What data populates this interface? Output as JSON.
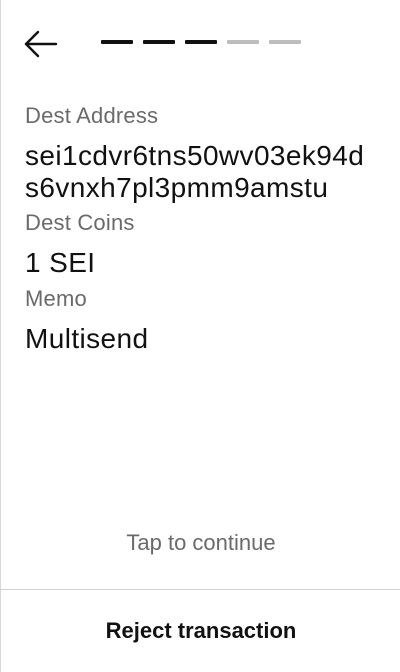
{
  "header": {
    "back_icon": "arrow-left-icon",
    "progress": {
      "total_steps": 5,
      "completed_steps": 3,
      "active_color": "#111111",
      "inactive_color": "#bdbdbd"
    }
  },
  "fields": {
    "dest_address": {
      "label": "Dest Address",
      "value": "sei1cdvr6tns50wv03ek94ds6vnxh7pl3pmm9amstu"
    },
    "dest_coins": {
      "label": "Dest Coins",
      "value": "1 SEI"
    },
    "memo": {
      "label": "Memo",
      "value": "Multisend"
    }
  },
  "footer": {
    "tap_hint": "Tap to continue",
    "reject_label": "Reject transaction"
  }
}
